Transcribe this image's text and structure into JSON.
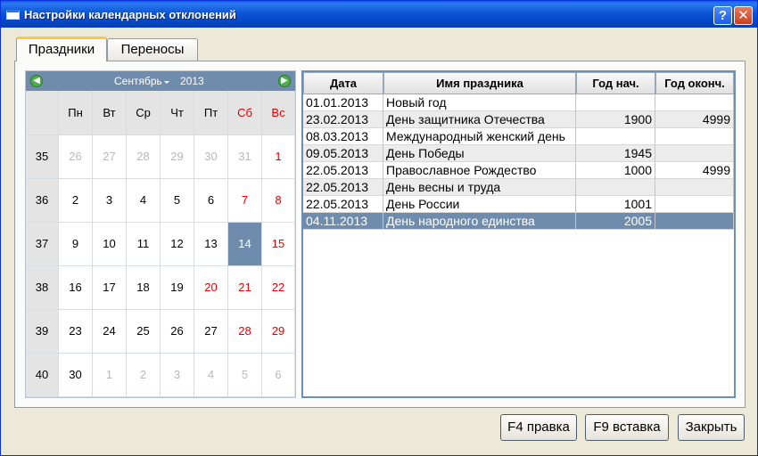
{
  "window": {
    "title": "Настройки календарных отклонений",
    "help_label": "?",
    "close_label": "✕"
  },
  "tabs": [
    {
      "label": "Праздники",
      "active": true
    },
    {
      "label": "Переносы",
      "active": false
    }
  ],
  "calendar": {
    "prev_icon": "arrow-left-icon",
    "next_icon": "arrow-right-icon",
    "month": "Сентябрь",
    "year": "2013",
    "weekdays": [
      "Пн",
      "Вт",
      "Ср",
      "Чт",
      "Пт",
      "Сб",
      "Вс"
    ],
    "weeks": [
      {
        "num": "35",
        "days": [
          {
            "d": "26",
            "m": true
          },
          {
            "d": "27",
            "m": true
          },
          {
            "d": "28",
            "m": true
          },
          {
            "d": "29",
            "m": true
          },
          {
            "d": "30",
            "m": true
          },
          {
            "d": "31",
            "m": true
          },
          {
            "d": "1",
            "r": true
          }
        ]
      },
      {
        "num": "36",
        "days": [
          {
            "d": "2"
          },
          {
            "d": "3"
          },
          {
            "d": "4"
          },
          {
            "d": "5"
          },
          {
            "d": "6"
          },
          {
            "d": "7",
            "r": true
          },
          {
            "d": "8",
            "r": true
          }
        ]
      },
      {
        "num": "37",
        "days": [
          {
            "d": "9"
          },
          {
            "d": "10"
          },
          {
            "d": "11"
          },
          {
            "d": "12"
          },
          {
            "d": "13"
          },
          {
            "d": "14",
            "s": true
          },
          {
            "d": "15",
            "r": true
          }
        ]
      },
      {
        "num": "38",
        "days": [
          {
            "d": "16"
          },
          {
            "d": "17"
          },
          {
            "d": "18"
          },
          {
            "d": "19"
          },
          {
            "d": "20",
            "r": true
          },
          {
            "d": "21",
            "r": true
          },
          {
            "d": "22",
            "r": true
          }
        ]
      },
      {
        "num": "39",
        "days": [
          {
            "d": "23"
          },
          {
            "d": "24"
          },
          {
            "d": "25"
          },
          {
            "d": "26"
          },
          {
            "d": "27"
          },
          {
            "d": "28",
            "r": true
          },
          {
            "d": "29",
            "r": true
          }
        ]
      },
      {
        "num": "40",
        "days": [
          {
            "d": "30"
          },
          {
            "d": "1",
            "m": true
          },
          {
            "d": "2",
            "m": true
          },
          {
            "d": "3",
            "m": true
          },
          {
            "d": "4",
            "m": true
          },
          {
            "d": "5",
            "m": true
          },
          {
            "d": "6",
            "m": true
          }
        ]
      }
    ]
  },
  "holidays": {
    "columns": [
      "Дата",
      "Имя праздника",
      "Год нач.",
      "Год оконч."
    ],
    "rows": [
      [
        "01.01.2013",
        "Новый год",
        "",
        ""
      ],
      [
        "23.02.2013",
        "День защитника Отечества",
        "1900",
        "4999"
      ],
      [
        "08.03.2013",
        "Международный женский день",
        "",
        ""
      ],
      [
        "09.05.2013",
        "День Победы",
        "1945",
        ""
      ],
      [
        "22.05.2013",
        "Православное Рождество",
        "1000",
        "4999"
      ],
      [
        "22.05.2013",
        "День весны и труда",
        "",
        ""
      ],
      [
        "22.05.2013",
        "День России",
        "1001",
        ""
      ],
      [
        "04.11.2013",
        "День народного единства",
        "2005",
        ""
      ]
    ],
    "selected_row": 7
  },
  "buttons": {
    "f4": "F4 правка",
    "f9": "F9 вставка",
    "close": "Закрыть"
  },
  "colors": {
    "selection": "#6f8cad",
    "weekend": "#e00000",
    "titlebar": "#0b56d6"
  }
}
